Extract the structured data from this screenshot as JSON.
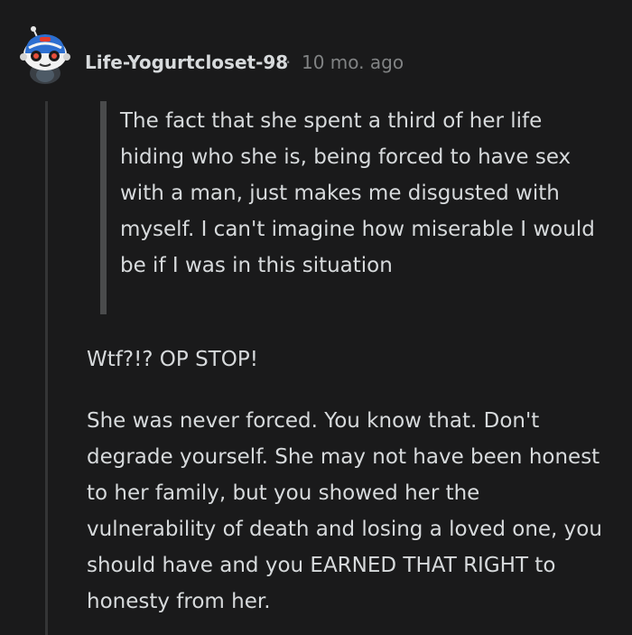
{
  "comment": {
    "username": "Life-Yogurtcloset-98",
    "separator": "·",
    "timestamp": "10 mo. ago",
    "avatar_icon": "reddit-snoo-helmet-avatar",
    "quote": "The fact that she spent a third of her life hiding who she is, being forced to have sex with a man, just makes me disgusted with myself. I can't imagine how miserable I would be if I was in this situation",
    "paragraphs": [
      "Wtf?!? OP STOP!",
      "She was never forced. You know that. Don't degrade yourself. She may not have been honest to her family, but you showed her the vulnerability of death and losing a loved one, you should have and you EARNED THAT RIGHT to honesty from her."
    ]
  },
  "colors": {
    "background": "#1a1a1b",
    "text": "#d7dadc",
    "muted": "#818384",
    "quote_bar": "#4a4b4c",
    "thread_line": "#343536"
  }
}
